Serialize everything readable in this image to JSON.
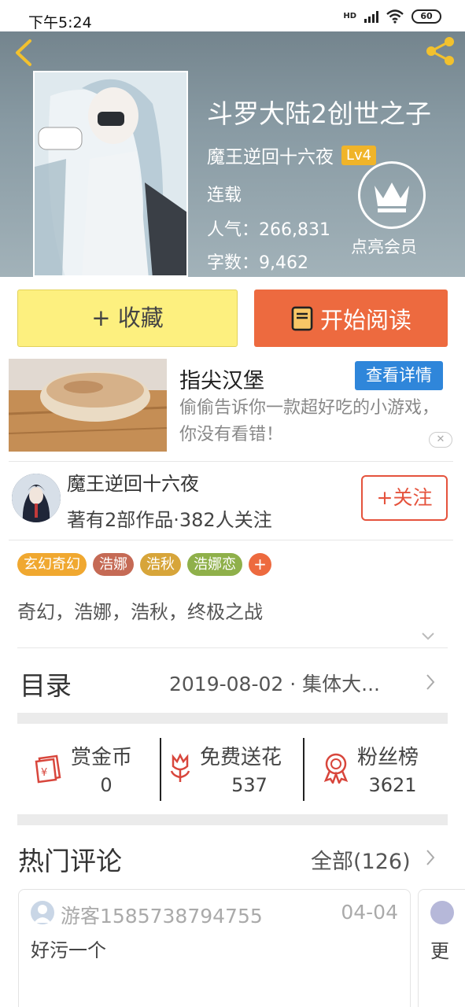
{
  "status_bar": {
    "time": "下午5:24",
    "network": "HD",
    "battery": "60"
  },
  "header": {
    "title": "斗罗大陆2创世之子",
    "author": "魔王逆回十六夜",
    "level": "Lv4",
    "status": "连载",
    "popularity": "人气：266,831",
    "word_count": "字数：9,462",
    "vip_label": "点亮会员"
  },
  "actions": {
    "collect": "+ 收藏",
    "read": "开始阅读"
  },
  "ad": {
    "title": "指尖汉堡",
    "detail_button": "查看详情",
    "description": "偷偷告诉你一款超好吃的小游戏，你没有看错！",
    "close": "✕"
  },
  "author": {
    "name": "魔王逆回十六夜",
    "stats": "著有2部作品·382人关注",
    "follow": "+关注"
  },
  "tags": [
    {
      "label": "玄幻奇幻",
      "color": "#f0a830"
    },
    {
      "label": "浩娜",
      "color": "#c56a55"
    },
    {
      "label": "浩秋",
      "color": "#d7a53a"
    },
    {
      "label": "浩娜恋",
      "color": "#8fb04a"
    }
  ],
  "tag_more": "+",
  "keywords": "奇幻，浩娜，浩秋，终极之战",
  "toc": {
    "title": "目录",
    "latest": "2019-08-02 · 集体大..."
  },
  "stats": [
    {
      "label": "赏金币",
      "value": "0"
    },
    {
      "label": "免费送花",
      "value": "537"
    },
    {
      "label": "粉丝榜",
      "value": "3621"
    }
  ],
  "comments": {
    "title": "热门评论",
    "all": "全部(126)",
    "items": [
      {
        "user": "游客1585738794755",
        "date": "04-04",
        "text": "好污一个"
      },
      {
        "text": "更"
      }
    ]
  },
  "colors": {
    "accent_orange": "#ed6a3f",
    "collect_yellow": "#fdf07f",
    "ad_blue": "#2f86da",
    "follow_red": "#e5533d"
  }
}
